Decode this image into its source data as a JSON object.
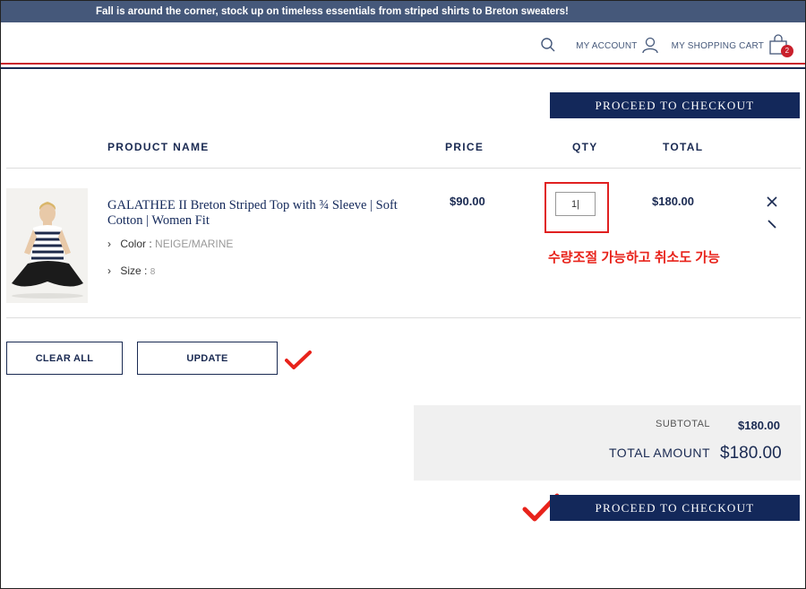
{
  "promo": {
    "text": "Fall is around the corner, stock up on timeless essentials from striped shirts to Breton sweaters!"
  },
  "header": {
    "account_label": "MY ACCOUNT",
    "cart_label": "MY SHOPPING CART",
    "cart_count": "2"
  },
  "checkout_label": "PROCEED TO CHECKOUT",
  "table": {
    "col_product": "PRODUCT NAME",
    "col_price": "PRICE",
    "col_qty": "QTY",
    "col_total": "TOTAL"
  },
  "item": {
    "name": "GALATHEE II Breton Striped Top with ¾ Sleeve | Soft Cotton | Women Fit",
    "color_label": "Color :",
    "color_value": "NEIGE/MARINE",
    "size_label": "Size :",
    "size_value": "8",
    "price": "$90.00",
    "qty": "1",
    "total": "$180.00"
  },
  "annotation": {
    "note": "수량조절 가능하고 취소도 가능"
  },
  "actions": {
    "clear_all": "CLEAR ALL",
    "update": "UPDATE"
  },
  "summary": {
    "subtotal_label": "SUBTOTAL",
    "subtotal_value": "$180.00",
    "total_label": "TOTAL AMOUNT",
    "total_value": "$180.00"
  },
  "colors": {
    "navy": "#13285a",
    "promo_bg": "#45587a",
    "accent_red": "#e8231b",
    "stripe_red": "#c9202c"
  },
  "icons": [
    "search-icon",
    "user-icon",
    "shopping-bag-icon",
    "close-icon",
    "edit-icon",
    "checkmark-icon"
  ]
}
